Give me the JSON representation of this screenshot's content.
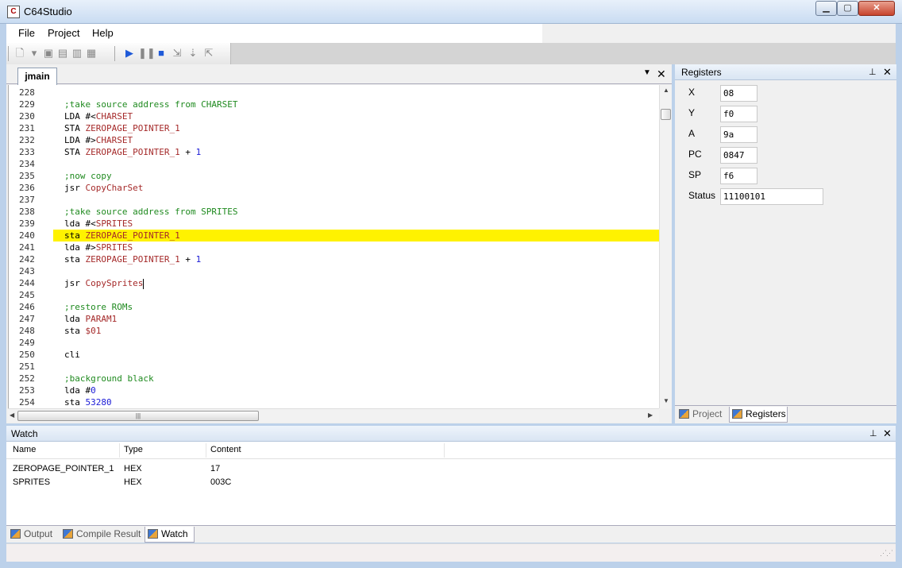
{
  "window": {
    "title": "C64Studio",
    "minimize": "▁",
    "maximize": "▢",
    "close": "✕"
  },
  "menu": {
    "items": [
      "File",
      "Project",
      "Help"
    ]
  },
  "toolbar": {
    "buttons": [
      {
        "name": "new-file-icon",
        "glyph": "🗋",
        "active": false
      },
      {
        "name": "new-dropdown-icon",
        "glyph": "▾",
        "active": false
      },
      {
        "name": "save-icon",
        "glyph": "▣",
        "active": false
      },
      {
        "name": "save-all-icon",
        "glyph": "▤",
        "active": false
      },
      {
        "name": "save-as-icon",
        "glyph": "▥",
        "active": false
      },
      {
        "name": "print-icon",
        "glyph": "▦",
        "active": false
      },
      {
        "name": "run-icon",
        "glyph": "▶",
        "active": true
      },
      {
        "name": "pause-icon",
        "glyph": "❚❚",
        "active": false
      },
      {
        "name": "stop-icon",
        "glyph": "■",
        "active": true
      },
      {
        "name": "step-into-icon",
        "glyph": "⇲",
        "active": false
      },
      {
        "name": "step-over-icon",
        "glyph": "⇣",
        "active": false
      },
      {
        "name": "step-out-icon",
        "glyph": "⇱",
        "active": false
      }
    ]
  },
  "document": {
    "tab_label": "jmain",
    "dropdown_glyph": "▼",
    "close_glyph": "✕"
  },
  "editor": {
    "highlight_line": 240,
    "lines": [
      {
        "no": "228",
        "tokens": []
      },
      {
        "no": "229",
        "tokens": [
          {
            "t": ";take source address from CHARSET",
            "c": "comment"
          }
        ]
      },
      {
        "no": "230",
        "tokens": [
          {
            "t": "LDA #<",
            "c": "op"
          },
          {
            "t": "CHARSET",
            "c": "label"
          }
        ]
      },
      {
        "no": "231",
        "tokens": [
          {
            "t": "STA ",
            "c": "op"
          },
          {
            "t": "ZEROPAGE_POINTER_1",
            "c": "label"
          }
        ]
      },
      {
        "no": "232",
        "tokens": [
          {
            "t": "LDA #>",
            "c": "op"
          },
          {
            "t": "CHARSET",
            "c": "label"
          }
        ]
      },
      {
        "no": "233",
        "tokens": [
          {
            "t": "STA ",
            "c": "op"
          },
          {
            "t": "ZEROPAGE_POINTER_1",
            "c": "label"
          },
          {
            "t": " + ",
            "c": "op"
          },
          {
            "t": "1",
            "c": "num"
          }
        ]
      },
      {
        "no": "234",
        "tokens": []
      },
      {
        "no": "235",
        "tokens": [
          {
            "t": ";now copy",
            "c": "comment"
          }
        ]
      },
      {
        "no": "236",
        "tokens": [
          {
            "t": "jsr ",
            "c": "op"
          },
          {
            "t": "CopyCharSet",
            "c": "label"
          }
        ]
      },
      {
        "no": "237",
        "tokens": []
      },
      {
        "no": "238",
        "tokens": [
          {
            "t": ";take source address from SPRITES",
            "c": "comment"
          }
        ]
      },
      {
        "no": "239",
        "tokens": [
          {
            "t": "lda #<",
            "c": "op"
          },
          {
            "t": "SPRITES",
            "c": "label"
          }
        ]
      },
      {
        "no": "240",
        "tokens": [
          {
            "t": "sta ",
            "c": "op"
          },
          {
            "t": "ZEROPAGE_POINTER_1",
            "c": "label"
          }
        ]
      },
      {
        "no": "241",
        "tokens": [
          {
            "t": "lda #>",
            "c": "op"
          },
          {
            "t": "SPRITES",
            "c": "label"
          }
        ]
      },
      {
        "no": "242",
        "tokens": [
          {
            "t": "sta ",
            "c": "op"
          },
          {
            "t": "ZEROPAGE_POINTER_1",
            "c": "label"
          },
          {
            "t": " + ",
            "c": "op"
          },
          {
            "t": "1",
            "c": "num"
          }
        ]
      },
      {
        "no": "243",
        "tokens": []
      },
      {
        "no": "244",
        "tokens": [
          {
            "t": "jsr ",
            "c": "op"
          },
          {
            "t": "CopySprites",
            "c": "label"
          }
        ],
        "caret": true
      },
      {
        "no": "245",
        "tokens": []
      },
      {
        "no": "246",
        "tokens": [
          {
            "t": ";restore ROMs",
            "c": "comment"
          }
        ]
      },
      {
        "no": "247",
        "tokens": [
          {
            "t": "lda ",
            "c": "op"
          },
          {
            "t": "PARAM1",
            "c": "label"
          }
        ]
      },
      {
        "no": "248",
        "tokens": [
          {
            "t": "sta ",
            "c": "op"
          },
          {
            "t": "$01",
            "c": "label"
          }
        ]
      },
      {
        "no": "249",
        "tokens": []
      },
      {
        "no": "250",
        "tokens": [
          {
            "t": "cli",
            "c": "op"
          }
        ]
      },
      {
        "no": "251",
        "tokens": []
      },
      {
        "no": "252",
        "tokens": [
          {
            "t": ";background black",
            "c": "comment"
          }
        ]
      },
      {
        "no": "253",
        "tokens": [
          {
            "t": "lda #",
            "c": "op"
          },
          {
            "t": "0",
            "c": "num"
          }
        ]
      },
      {
        "no": "254",
        "tokens": [
          {
            "t": "sta ",
            "c": "op"
          },
          {
            "t": "53280",
            "c": "num"
          }
        ]
      }
    ]
  },
  "registers": {
    "title": "Registers",
    "pin_glyph": "⊥",
    "close_glyph": "✕",
    "items": [
      {
        "label": "X",
        "value": "08"
      },
      {
        "label": "Y",
        "value": "f0"
      },
      {
        "label": "A",
        "value": "9a"
      },
      {
        "label": "PC",
        "value": "0847"
      },
      {
        "label": "SP",
        "value": "f6"
      },
      {
        "label": "Status",
        "value": "11100101"
      }
    ],
    "tabs": [
      "Project",
      "Registers"
    ]
  },
  "watch": {
    "title": "Watch",
    "columns": [
      "Name",
      "Type",
      "Content"
    ],
    "rows": [
      [
        "ZEROPAGE_POINTER_1",
        "HEX",
        "17"
      ],
      [
        "SPRITES",
        "HEX",
        "003C"
      ]
    ]
  },
  "bottom_tabs": [
    "Output",
    "Compile Result",
    "Watch"
  ],
  "colors": {
    "highlight": "#fff200",
    "comment": "#1f8a1f",
    "label": "#a52a2a",
    "number": "#1a1ad6"
  }
}
